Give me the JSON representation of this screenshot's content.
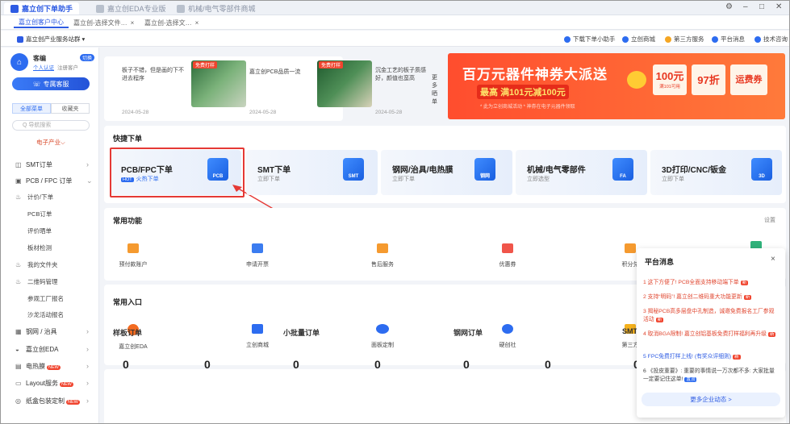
{
  "titlebar": {
    "tabs": [
      {
        "label": "嘉立创下单助手",
        "active": true
      },
      {
        "label": "嘉立创EDA专业版",
        "active": false
      },
      {
        "label": "机械/电气零部件商城",
        "active": false
      }
    ]
  },
  "subtabs": [
    "嘉立创客户中心",
    "嘉立创-选择文件…",
    "嘉立创-选择文…"
  ],
  "toolbar": {
    "service_station": "嘉立创产业服务站群",
    "links": [
      "下载下单小助手",
      "立创商城",
      "第三方服务",
      "平台消息",
      "技术咨询"
    ]
  },
  "sidebar": {
    "user_name": "客编",
    "switch_label": "切换",
    "auth_label": "个人认证",
    "register_label": "注册客户",
    "exclusive_btn": "专属客服",
    "all_menu": "全部菜单",
    "favorites": "收藏夹",
    "search_placeholder": "Q 导航搜索",
    "section_label": "电子产业",
    "items": [
      {
        "icon": "smt-icon",
        "label": "SMT订单",
        "chev": true,
        "sub": false
      },
      {
        "icon": "pcb-icon",
        "label": "PCB / FPC 订单",
        "chev": true,
        "sub": false
      },
      {
        "icon": "flame-icon",
        "label": "计价/下单",
        "chev": false,
        "sub": true,
        "flame": true
      },
      {
        "icon": "",
        "label": "PCB订单",
        "chev": false,
        "sub": true
      },
      {
        "icon": "",
        "label": "评价晒单",
        "chev": false,
        "sub": true
      },
      {
        "icon": "",
        "label": "板材检测",
        "chev": false,
        "sub": true
      },
      {
        "icon": "flame-icon",
        "label": "我的文件夹",
        "chev": false,
        "sub": true,
        "flame": true
      },
      {
        "icon": "flame-icon",
        "label": "二维码管理",
        "chev": false,
        "sub": true,
        "flame": true
      },
      {
        "icon": "",
        "label": "参观工厂报名",
        "chev": false,
        "sub": true
      },
      {
        "icon": "",
        "label": "沙龙活动报名",
        "chev": false,
        "sub": true
      },
      {
        "icon": "stencil-icon",
        "label": "钢网 / 治具",
        "chev": true,
        "sub": false
      },
      {
        "icon": "eda-icon",
        "label": "嘉立创EDA",
        "chev": true,
        "sub": false
      },
      {
        "icon": "heat-icon",
        "label": "电热膜",
        "chev": true,
        "sub": false,
        "hot": "NEW"
      },
      {
        "icon": "layout-icon",
        "label": "Layout服务",
        "chev": true,
        "sub": false,
        "hot": "NEW"
      },
      {
        "icon": "box-icon",
        "label": "纸盒包装定制",
        "chev": true,
        "sub": false,
        "hot": "NEW"
      }
    ]
  },
  "news": [
    {
      "text": "板子不错，但是画的下不进去程序",
      "date": "2024-05-28",
      "badge": ""
    },
    {
      "text": "嘉立创PCB品质一流",
      "date": "2024-05-28",
      "badge": "免费打样"
    },
    {
      "text": "沉金工艺的板子质感好，颜值也蛮高",
      "date": "2024-05-28",
      "badge": "免费打样"
    }
  ],
  "more_label": "更多晒单",
  "banner": {
    "title": "百万元器件神券大派送",
    "sub1": "最高",
    "sub2": "满101元减100元",
    "small": "* 此为立创商城活动 * 神券在电子元器件领取",
    "coupon1": "100元",
    "coupon1_sub": "满101可用",
    "coupon2": "97折",
    "coupon3": "运费券"
  },
  "quick": {
    "title": "快捷下单",
    "cards": [
      {
        "title": "PCB/FPC下单",
        "sub": "火热下单",
        "icon_text": "PCB"
      },
      {
        "title": "SMT下单",
        "sub": "立即下单",
        "icon_text": "SMT"
      },
      {
        "title": "钢网/治具/电热膜",
        "sub": "立即下单",
        "icon_text": "钢网"
      },
      {
        "title": "机械/电气零部件",
        "sub": "立即选型",
        "icon_text": "FA"
      },
      {
        "title": "3D打印/CNC/钣金",
        "sub": "立即下单",
        "icon_text": "3D"
      }
    ]
  },
  "functions": {
    "title": "常用功能",
    "settings": "设置",
    "items": [
      {
        "label": "预付款账户",
        "color": "#f59a2f"
      },
      {
        "label": "申请开票",
        "color": "#3b7cf0"
      },
      {
        "label": "售后服务",
        "color": "#f59a2f"
      },
      {
        "label": "优惠券",
        "color": "#f0554a"
      },
      {
        "label": "积分兑",
        "color": "#f59a2f"
      },
      {
        "label": "",
        "color": "#2fb27a"
      }
    ]
  },
  "entries": {
    "title": "常用入口",
    "items": [
      {
        "label": "嘉立创EDA",
        "color": "#f36b21"
      },
      {
        "label": "立创商城",
        "color": "#2d6cf0"
      },
      {
        "label": "面板定制",
        "color": "#2d6cf0"
      },
      {
        "label": "硬创社",
        "color": "#2d6cf0"
      },
      {
        "label": "第三方",
        "color": "#f5b21e"
      }
    ]
  },
  "orders": {
    "cols": [
      "样板订单",
      "小批量订单",
      "钢网订单",
      "SMT"
    ],
    "values": [
      "0",
      "0",
      "0",
      "0",
      "0",
      "0",
      "0"
    ]
  },
  "popup": {
    "title": "平台消息",
    "close": "×",
    "items": [
      {
        "n": "1",
        "text": "这下方便了! PCB全面支持移动端下单",
        "tag": "新",
        "red": true
      },
      {
        "n": "2",
        "text": "支持“明码”! 嘉立创二维码重大功能更新",
        "tag": "新",
        "red": true
      },
      {
        "n": "3",
        "text": "揭秘PCB高多层盘中孔制造，诚邀免费报名工厂参观活动",
        "tag": "新",
        "red": true
      },
      {
        "n": "4",
        "text": "取消BGA限制! 嘉立创铝基板免费打样福利再升级",
        "tag": "新",
        "red": true
      },
      {
        "n": "5",
        "text": "FPC免费打样上线! (有奖众评细则)",
        "tag": "新",
        "red": false,
        "blue": true
      },
      {
        "n": "6",
        "text": "《投皮重要》: 重要的事情说一万次都不多: 大家批量一定要记住这单!",
        "tag": "置顶",
        "red": false
      }
    ],
    "more": "更多企业动态 >"
  },
  "colors": {
    "brand": "#2d5be3",
    "accent": "#f0442e",
    "annotation": "#e53935"
  }
}
